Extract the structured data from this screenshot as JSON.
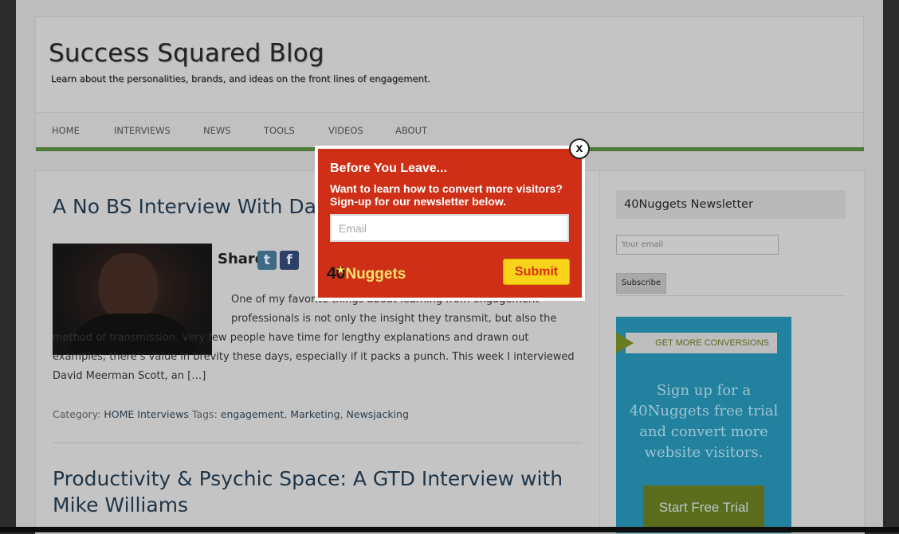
{
  "colors": {
    "nav_rule": "#4f7a3a",
    "modal_bg": "#cf2f16",
    "submit_bg": "#f9d21a",
    "promo_bg": "#21819e",
    "promo_button": "#5b6d1c"
  },
  "site": {
    "title": "Success Squared Blog",
    "tagline": "Learn about the personalities, brands, and ideas on the front lines of engagement."
  },
  "nav": {
    "items": [
      {
        "label": "HOME"
      },
      {
        "label": "INTERVIEWS"
      },
      {
        "label": "NEWS"
      },
      {
        "label": "TOOLS"
      },
      {
        "label": "VIDEOS"
      },
      {
        "label": "ABOUT"
      }
    ]
  },
  "post1": {
    "title": "A No BS Interview With Da",
    "share_label": "Share",
    "share_icons": [
      "twitter-icon",
      "facebook-icon"
    ],
    "excerpt_line1": "One of my favorite things about learning from engagement",
    "excerpt_rest": "professionals is not only the insight they transmit, but also the method of transmission. Very few people have time for lengthy explanations and drawn out examples; there’s value in brevity these days, especially if it packs a punch. This week I interviewed David Meerman Scott, an […]",
    "category_label": "Category:",
    "categories": [
      "HOME",
      "Interviews"
    ],
    "tags_label": "Tags:",
    "tags": [
      "engagement",
      "Marketing",
      "Newsjacking"
    ]
  },
  "post2": {
    "title_line1": "Productivity & Psychic Space: A GTD Interview with",
    "title_line2": "Mike Williams"
  },
  "sidebar": {
    "newsletter_title": "40Nuggets Newsletter",
    "email_placeholder": "Your email",
    "subscribe_label": "Subscribe",
    "promo": {
      "ribbon": "GET MORE CONVERSIONS",
      "text": "Sign up for a 40Nuggets free trial and convert more website visitors.",
      "button": "Start Free Trial"
    }
  },
  "modal": {
    "close": "x",
    "title": "Before You Leave...",
    "text": "Want to learn how to convert more visitors? Sign-up for our newsletter below.",
    "email_placeholder": "Email",
    "logo_number": "40",
    "logo_word": "Nuggets",
    "submit": "Submit"
  }
}
